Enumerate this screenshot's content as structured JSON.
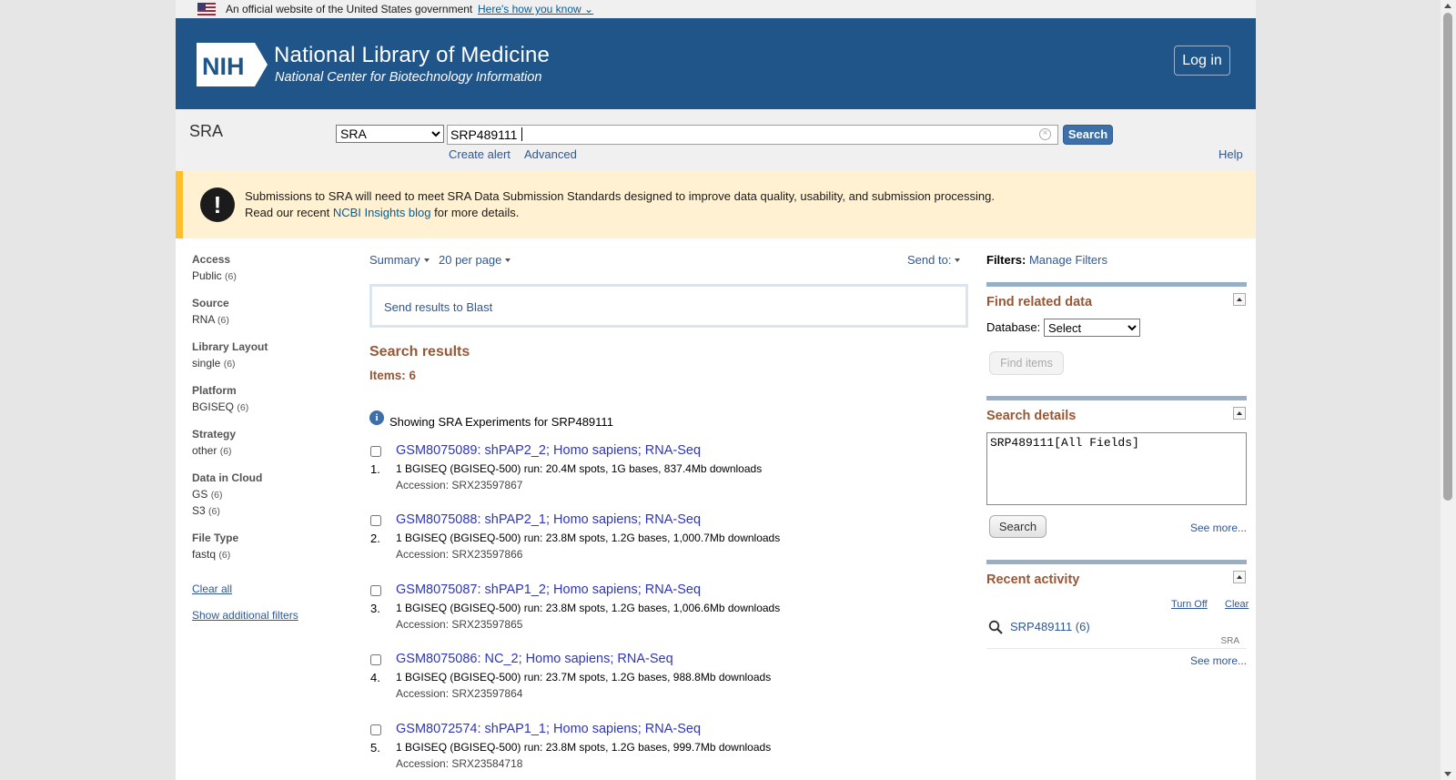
{
  "gov_banner": {
    "text": "An official website of the United States government",
    "link": "Here's how you know"
  },
  "header": {
    "logo_text": "NIH",
    "title": "National Library of Medicine",
    "subtitle": "National Center for Biotechnology Information",
    "login": "Log in"
  },
  "search": {
    "db_label": "SRA",
    "db_select": "SRA",
    "query": "SRP489111",
    "button": "Search",
    "create_alert": "Create alert",
    "advanced": "Advanced",
    "help": "Help"
  },
  "notice": {
    "line1": "Submissions to SRA will need to meet SRA Data Submission Standards designed to improve data quality, usability, and submission processing.",
    "line2_pre": "Read our recent ",
    "line2_link": "NCBI Insights blog",
    "line2_post": " for more details."
  },
  "filters": [
    {
      "heading": "Access",
      "items": [
        {
          "label": "Public",
          "count": "(6)"
        }
      ]
    },
    {
      "heading": "Source",
      "items": [
        {
          "label": "RNA",
          "count": "(6)"
        }
      ]
    },
    {
      "heading": "Library Layout",
      "items": [
        {
          "label": "single",
          "count": "(6)"
        }
      ]
    },
    {
      "heading": "Platform",
      "items": [
        {
          "label": "BGISEQ",
          "count": "(6)"
        }
      ]
    },
    {
      "heading": "Strategy",
      "items": [
        {
          "label": "other",
          "count": "(6)"
        }
      ]
    },
    {
      "heading": "Data in Cloud",
      "items": [
        {
          "label": "GS",
          "count": "(6)"
        },
        {
          "label": "S3",
          "count": "(6)"
        }
      ]
    },
    {
      "heading": "File Type",
      "items": [
        {
          "label": "fastq",
          "count": "(6)"
        }
      ]
    }
  ],
  "filter_links": {
    "clear_all": "Clear all",
    "show_additional": "Show additional filters"
  },
  "display": {
    "format": "Summary",
    "per_page": "20 per page",
    "send_to": "Send to:"
  },
  "blast_link": "Send results to Blast",
  "results": {
    "title": "Search results",
    "items": "Items: 6",
    "showing": "Showing SRA Experiments for SRP489111",
    "list": [
      {
        "num": "1.",
        "title": "GSM8075089: shPAP2_2; Homo sapiens; RNA-Seq",
        "desc": "1 BGISEQ (BGISEQ-500) run: 20.4M spots, 1G bases, 837.4Mb downloads",
        "accession": "Accession: SRX23597867"
      },
      {
        "num": "2.",
        "title": "GSM8075088: shPAP2_1; Homo sapiens; RNA-Seq",
        "desc": "1 BGISEQ (BGISEQ-500) run: 23.8M spots, 1.2G bases, 1,000.7Mb downloads",
        "accession": "Accession: SRX23597866"
      },
      {
        "num": "3.",
        "title": "GSM8075087: shPAP1_2; Homo sapiens; RNA-Seq",
        "desc": "1 BGISEQ (BGISEQ-500) run: 23.8M spots, 1.2G bases, 1,006.6Mb downloads",
        "accession": "Accession: SRX23597865"
      },
      {
        "num": "4.",
        "title": "GSM8075086: NC_2; Homo sapiens; RNA-Seq",
        "desc": "1 BGISEQ (BGISEQ-500) run: 23.7M spots, 1.2G bases, 988.8Mb downloads",
        "accession": "Accession: SRX23597864"
      },
      {
        "num": "5.",
        "title": "GSM8072574: shPAP1_1; Homo sapiens; RNA-Seq",
        "desc": "1 BGISEQ (BGISEQ-500) run: 23.8M spots, 1.2G bases, 999.7Mb downloads",
        "accession": "Accession: SRX23584718"
      }
    ]
  },
  "sidebar": {
    "filters_label": "Filters:",
    "manage_filters": "Manage Filters",
    "related": {
      "title": "Find related data",
      "db_label": "Database:",
      "db_select": "Select",
      "button": "Find items"
    },
    "details": {
      "title": "Search details",
      "query": "SRP489111[All Fields]",
      "button": "Search",
      "see_more": "See more..."
    },
    "activity": {
      "title": "Recent activity",
      "turn_off": "Turn Off",
      "clear": "Clear",
      "item": "SRP489111 (6)",
      "item_db": "SRA",
      "see_more": "See more..."
    }
  },
  "icons": {
    "flag": "us-flag-icon",
    "alert": "exclamation-icon",
    "info": "info-icon",
    "search": "magnifier-icon"
  },
  "colors": {
    "header_bg": "#20558a",
    "notice_bg": "#fff1d2",
    "notice_border": "#ffbe2e",
    "section_title": "#985735",
    "link": "#2f5796"
  }
}
